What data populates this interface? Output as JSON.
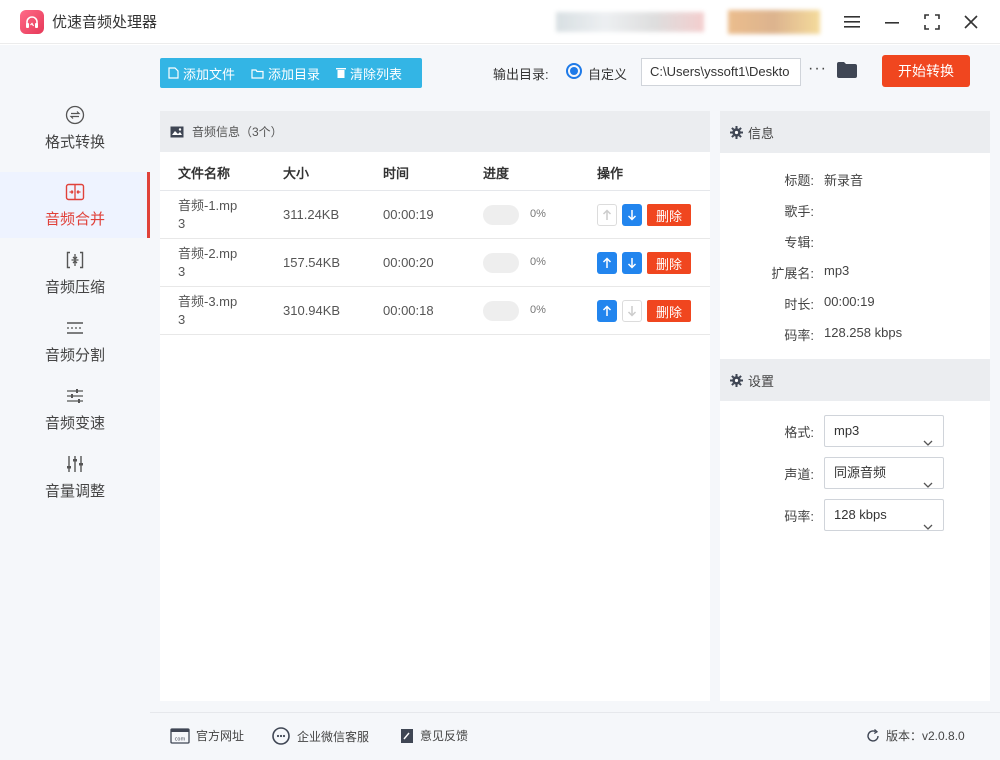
{
  "app": {
    "title": "优速音频处理器"
  },
  "sidebar": {
    "items": [
      {
        "label": "格式转换",
        "icon": "format-convert-icon"
      },
      {
        "label": "音频合并",
        "icon": "merge-icon",
        "active": true
      },
      {
        "label": "音频压缩",
        "icon": "compress-icon"
      },
      {
        "label": "音频分割",
        "icon": "split-icon"
      },
      {
        "label": "音频变速",
        "icon": "speed-icon"
      },
      {
        "label": "音量调整",
        "icon": "volume-icon"
      }
    ]
  },
  "toolbar": {
    "add_file": "添加文件",
    "add_dir": "添加目录",
    "clear_list": "清除列表",
    "output_label": "输出目录:",
    "custom_label": "自定义",
    "output_path": "C:\\Users\\yssoft1\\Deskto",
    "more": "···",
    "start_button": "开始转换"
  },
  "list": {
    "header": "音频信息（3个）",
    "columns": {
      "name": "文件名称",
      "size": "大小",
      "time": "时间",
      "progress": "进度",
      "actions": "操作"
    },
    "rows": [
      {
        "name_1": "音频-1.mp",
        "name_2": "3",
        "size": "311.24KB",
        "time": "00:00:19",
        "progress": "0%",
        "up_enabled": false,
        "down_enabled": true,
        "delete": "删除"
      },
      {
        "name_1": "音频-2.mp",
        "name_2": "3",
        "size": "157.54KB",
        "time": "00:00:20",
        "progress": "0%",
        "up_enabled": true,
        "down_enabled": true,
        "delete": "删除"
      },
      {
        "name_1": "音频-3.mp",
        "name_2": "3",
        "size": "310.94KB",
        "time": "00:00:18",
        "progress": "0%",
        "up_enabled": true,
        "down_enabled": false,
        "delete": "删除"
      }
    ]
  },
  "info": {
    "header": "信息",
    "fields": [
      {
        "key": "标题:",
        "value": "新录音"
      },
      {
        "key": "歌手:",
        "value": ""
      },
      {
        "key": "专辑:",
        "value": ""
      },
      {
        "key": "扩展名:",
        "value": "mp3"
      },
      {
        "key": "时长:",
        "value": "00:00:19"
      },
      {
        "key": "码率:",
        "value": "128.258 kbps"
      }
    ]
  },
  "settings": {
    "header": "设置",
    "format_label": "格式:",
    "format_value": "mp3",
    "channel_label": "声道:",
    "channel_value": "同源音频",
    "bitrate_label": "码率:",
    "bitrate_value": "128 kbps"
  },
  "status": {
    "website": "官方网址",
    "wechat": "企业微信客服",
    "feedback": "意见反馈",
    "version": "版本：v2.0.8.0"
  },
  "colors": {
    "accent_red": "#f0461f",
    "blue": "#33b5e5",
    "arrow_blue": "#2285ee",
    "active_text": "#e0413a"
  }
}
